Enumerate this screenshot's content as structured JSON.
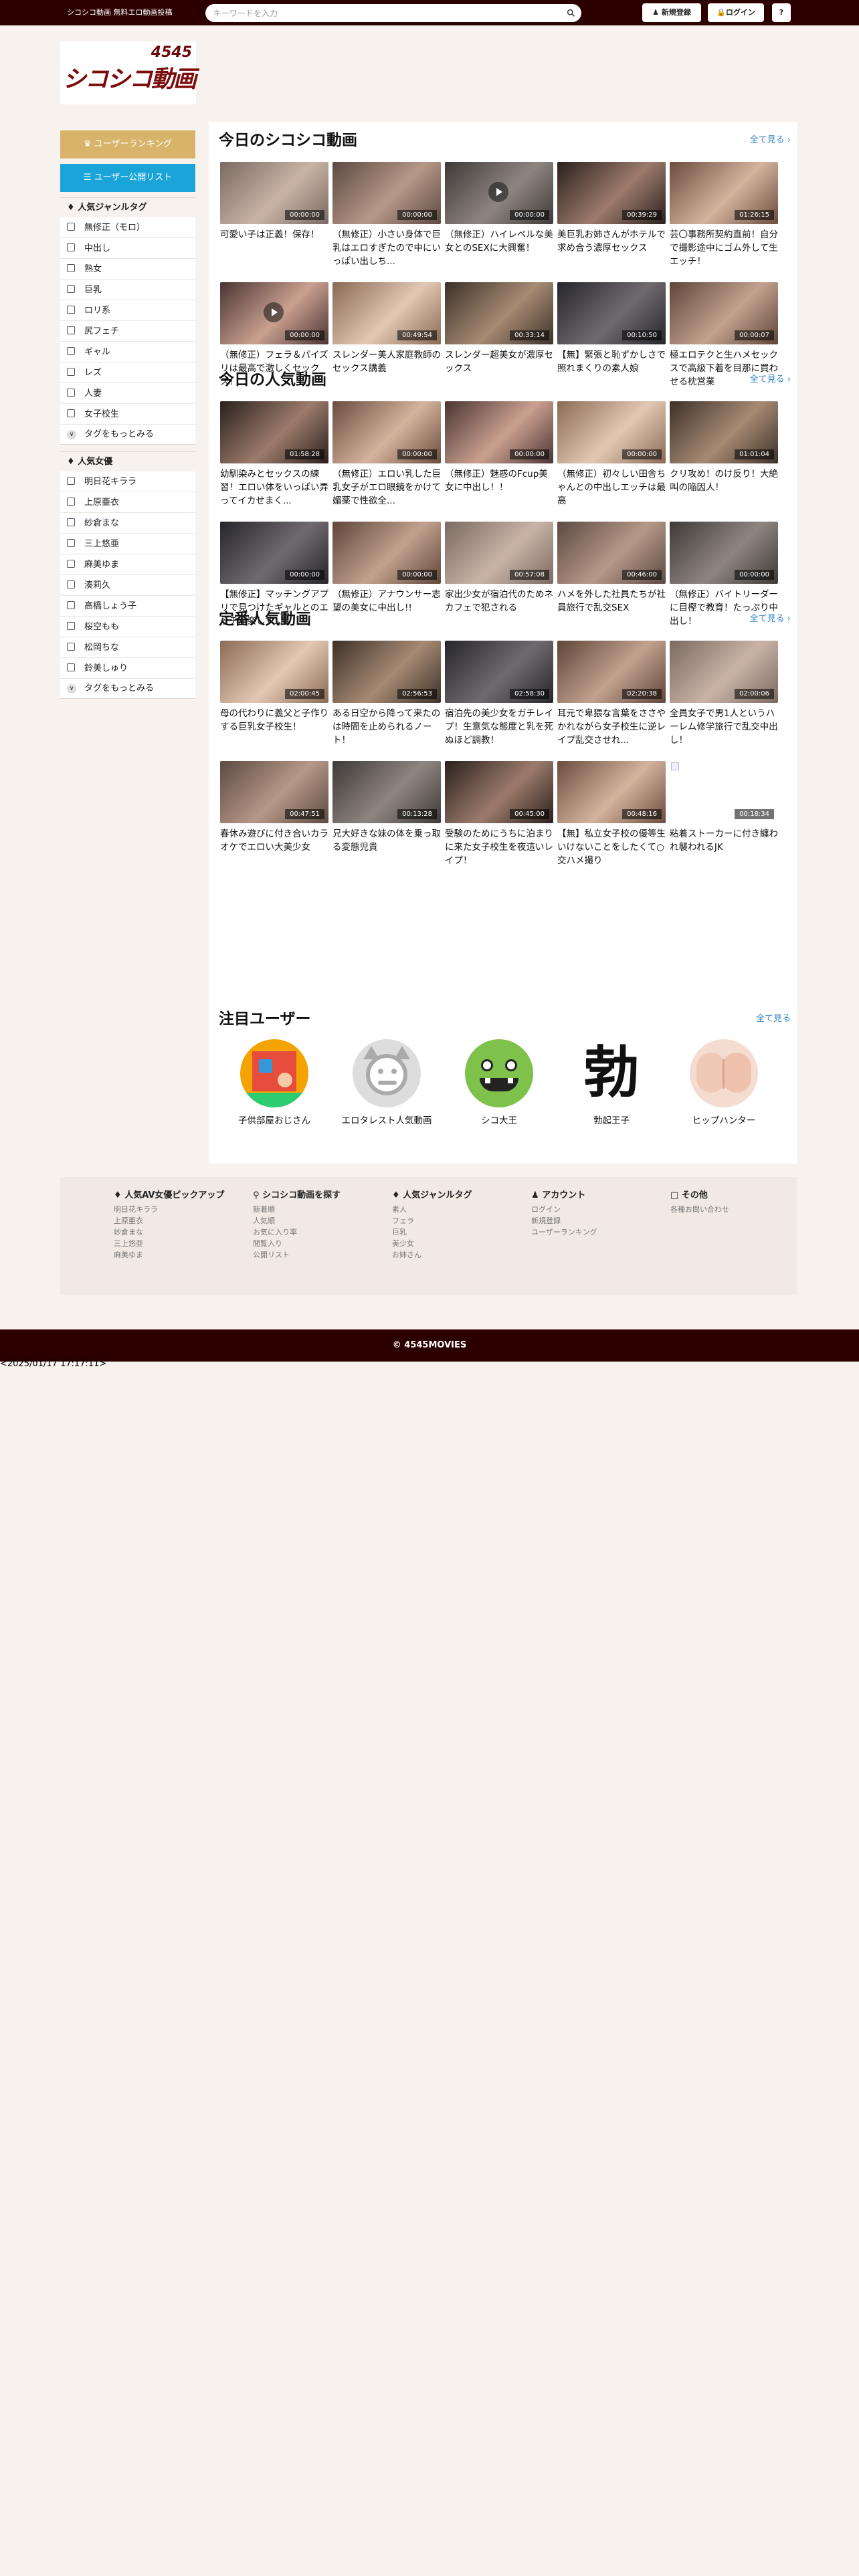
{
  "header": {
    "site_desc": "シコシコ動画 無料エロ動画投稿",
    "search_placeholder": "キーワードを入力",
    "register_label": "新規登録",
    "login_label": "ログイン",
    "help_label": "?"
  },
  "logo": {
    "top_text": "4545",
    "main_text": "シコシコ動画"
  },
  "sidebar": {
    "ranking_button": "ユーザーランキング",
    "public_list_button": "ユーザー公開リスト",
    "genres_title": "人気ジャンルタグ",
    "genres": [
      "無修正（モロ）",
      "中出し",
      "熟女",
      "巨乳",
      "ロリ系",
      "尻フェチ",
      "ギャル",
      "レズ",
      "人妻",
      "女子校生"
    ],
    "genres_more": "タグをもっとみる",
    "actresses_title": "人気女優",
    "actresses": [
      "明日花キララ",
      "上原亜衣",
      "紗倉まな",
      "三上悠亜",
      "麻美ゆま",
      "湊莉久",
      "高橋しょう子",
      "桜空もも",
      "松岡ちな",
      "鈴美しゅり"
    ],
    "actresses_more": "タグをもっとみる"
  },
  "sections": [
    {
      "title": "今日のシコシコ動画",
      "see_all": "全て見る",
      "videos": [
        {
          "caption": "可愛い子は正義！保存！",
          "duration": "00:00:00",
          "play": false
        },
        {
          "caption": "（無修正）小さい身体で巨乳はエロすぎたので中にいっぱい出しち...",
          "duration": "00:00:00",
          "play": false
        },
        {
          "caption": "（無修正）ハイレベルな美女とのSEXに大興奮！",
          "duration": "00:00:00",
          "play": true
        },
        {
          "caption": "美巨乳お姉さんがホテルで求め合う濃厚セックス",
          "duration": "00:39:29",
          "play": false
        },
        {
          "caption": "芸〇事務所契約直前！自分で撮影途中にゴム外して生エッチ！",
          "duration": "01:26:15",
          "play": false
        },
        {
          "caption": "（無修正）フェラ＆パイズリは最高で激しくセックス！",
          "duration": "00:00:00",
          "play": true
        },
        {
          "caption": "スレンダー美人家庭教師のセックス講義",
          "duration": "00:49:54",
          "play": false
        },
        {
          "caption": "スレンダー超美女が濃厚セックス",
          "duration": "00:33:14",
          "play": false
        },
        {
          "caption": "【無】緊張と恥ずかしさで照れまくりの素人娘",
          "duration": "00:10:50",
          "play": false
        },
        {
          "caption": "極エロテクと生ハメセックスで高級下着を目那に買わせる枕営業",
          "duration": "00:00:07",
          "play": false
        }
      ]
    },
    {
      "title": "今日の人気動画",
      "see_all": "全て見る",
      "videos": [
        {
          "caption": "幼馴染みとセックスの練習！エロい体をいっぱい弄ってイカせまく...",
          "duration": "01:58:28",
          "play": false
        },
        {
          "caption": "（無修正）エロい乳した巨乳女子がエロ眼鏡をかけて媚薬で性欲全...",
          "duration": "00:00:00",
          "play": false
        },
        {
          "caption": "（無修正）魅惑のFcup美女に中出し！！",
          "duration": "00:00:00",
          "play": false
        },
        {
          "caption": "（無修正）初々しい田舎ちゃんとの中出しエッチは最高",
          "duration": "00:00:00",
          "play": false
        },
        {
          "caption": "クリ攻め！のけ反り！大絶叫の陥因人！",
          "duration": "01:01:04",
          "play": false
        },
        {
          "caption": "【無修正】マッチングアプリで見つけたギャルとのエッチが楽しす...",
          "duration": "00:00:00",
          "play": false
        },
        {
          "caption": "（無修正）アナウンサー志望の美女に中出し!!",
          "duration": "00:00:00",
          "play": false
        },
        {
          "caption": "家出少女が宿泊代のためネカフェで犯される",
          "duration": "00:57:08",
          "play": false
        },
        {
          "caption": "ハメを外した社員たちが社員旅行で乱交SEX",
          "duration": "00:46:00",
          "play": false
        },
        {
          "caption": "（無修正）バイトリーダーに目樫で教育！たっぷり中出し！",
          "duration": "00:00:00",
          "play": false
        }
      ]
    },
    {
      "title": "定番人気動画",
      "see_all": "全て見る",
      "videos": [
        {
          "caption": "母の代わりに義父と子作りする巨乳女子校生！",
          "duration": "02:00:45",
          "play": false
        },
        {
          "caption": "ある日空から降って来たのは時間を止められるノート！",
          "duration": "02:56:53",
          "play": false
        },
        {
          "caption": "宿泊先の美少女をガチレイプ！生意気な態度と乳を死ぬほど調教！",
          "duration": "02:58:30",
          "play": false
        },
        {
          "caption": "耳元で卑猥な言葉をささやかれながら女子校生に逆レイプ乱交させれ...",
          "duration": "02:20:38",
          "play": false
        },
        {
          "caption": "全員女子で男1人というハーレム修学旅行で乱交中出し！",
          "duration": "02:00:06",
          "play": false
        },
        {
          "caption": "春休み遊びに付き合いカラオケでエロい大美少女",
          "duration": "00:47:51",
          "play": false
        },
        {
          "caption": "兄大好きな妹の体を乗っ取る変態児貴",
          "duration": "00:13:28",
          "play": false
        },
        {
          "caption": "受験のためにうちに泊まりに来た女子校生を夜這いレイプ！",
          "duration": "00:45:00",
          "play": false
        },
        {
          "caption": "【無】私立女子校の優等生 いけないことをしたくて○交ハメ撮り",
          "duration": "00:48:16",
          "play": false
        },
        {
          "caption": "粘着ストーカーに付き纏われ襲われるJK",
          "duration": "00:18:34",
          "play": false
        }
      ]
    }
  ],
  "users_section": {
    "title": "注目ユーザー",
    "see_all": "全て見る",
    "users": [
      {
        "name": "子供部屋おじさん",
        "avatar": "room-avatar"
      },
      {
        "name": "エロタレスト人気動画",
        "avatar": "default-face-avatar"
      },
      {
        "name": "シコ大王",
        "avatar": "green-monster-avatar"
      },
      {
        "name": "勃起王子",
        "avatar": "kanji-avatar",
        "avatar_text": "勃"
      },
      {
        "name": "ヒップハンター",
        "avatar": "hip-avatar"
      }
    ]
  },
  "footer": {
    "columns": [
      {
        "title": "人気AV女優ピックアップ",
        "links": [
          "明日花キララ",
          "上原亜衣",
          "紗倉まな",
          "三上悠亜",
          "麻美ゆま"
        ]
      },
      {
        "title": "シコシコ動画を探す",
        "links": [
          "新着順",
          "人気順",
          "お気に入り率",
          "閲覧入り",
          "公開リスト"
        ]
      },
      {
        "title": "人気ジャンルタグ",
        "links": [
          "素人",
          "フェラ",
          "巨乳",
          "美少女",
          "お姉さん"
        ]
      },
      {
        "title": "アカウント",
        "links": [
          "ログイン",
          "新規登録",
          "ユーザーランキング"
        ]
      },
      {
        "title": "その他",
        "links": [
          "各種お問い合わせ"
        ]
      }
    ],
    "copyright": "© 4545MOVIES",
    "timestamp": "<2025/01/17 17:17:11>"
  },
  "colors": {
    "header_bg": "#2d0000",
    "page_bg": "#f7f2ee",
    "gold": "#d8b46a",
    "blue": "#1ba4d8",
    "link": "#3a87c8"
  }
}
